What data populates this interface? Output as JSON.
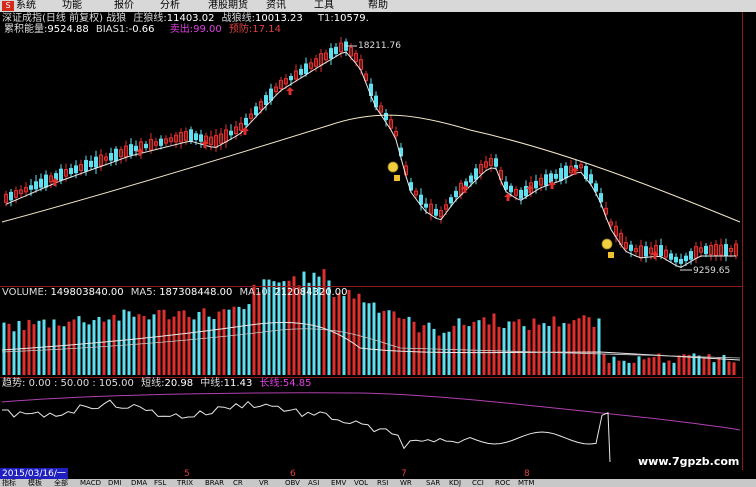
{
  "menu": {
    "items": [
      "系统",
      "功能",
      "报价",
      "分析",
      "港股期货",
      "资讯",
      "工具",
      "帮助"
    ]
  },
  "main_panel": {
    "title": "深证成指(日线 前复权) 战狼",
    "zhuang_label": "庄狼线:",
    "zhuang_value": "11403.02",
    "zhan_label": "战狼线:",
    "zhan_value": "10013.23",
    "t1_label": "T1:",
    "t1_value": "10579.",
    "accum_label": "累积能量:",
    "accum_value": "9524.88",
    "bias_label": "BIAS1:",
    "bias_value": "-0.66",
    "sell_label": "卖出:",
    "sell_value": "99.00",
    "warn_label": "预防:",
    "warn_value": "17.14",
    "high_label": "18211.76",
    "low_label": "9259.65"
  },
  "volume_panel": {
    "volume_label": "VOLUME:",
    "volume_value": "149803840.00",
    "ma5_label": "MA5:",
    "ma5_value": "187308448.00",
    "ma10_label": "MA10:",
    "ma10_value": "212084320.00"
  },
  "trend_panel": {
    "trend_label": "趋势:",
    "trend_values": "0.00 : 50.00 : 105.00",
    "short_label": "短线:",
    "short_value": "20.98",
    "mid_label": "中线:",
    "mid_value": "11.43",
    "long_label": "长线:",
    "long_value": "54.85",
    "watermark": "www.7gpzb.com"
  },
  "date_axis": {
    "current_date": "2015/03/16/一",
    "month_labels": [
      "5",
      "6",
      "7",
      "8"
    ]
  },
  "bottom_tabs": [
    "指标",
    "模板",
    "全部",
    "MACD",
    "DMI",
    "DMA",
    "FSL",
    "TRIX",
    "BRAR",
    "CR",
    "VR",
    "OBV",
    "ASI",
    "EMV",
    "VOL",
    "RSI",
    "WR",
    "SAR",
    "KDJ",
    "CCI",
    "ROC",
    "MTM"
  ],
  "colors": {
    "up": "#e0302e",
    "down": "#5fe0f0",
    "ma": "#e8e8e8",
    "long_line": "#b040b0",
    "menu_bg": "#d8d8d8",
    "label_yellow": "#f0e040",
    "label_red": "#e04040",
    "label_magenta": "#e040e0"
  },
  "chart_data": {
    "type": "candlestick",
    "high": 18211.76,
    "low": 9259.65
  }
}
